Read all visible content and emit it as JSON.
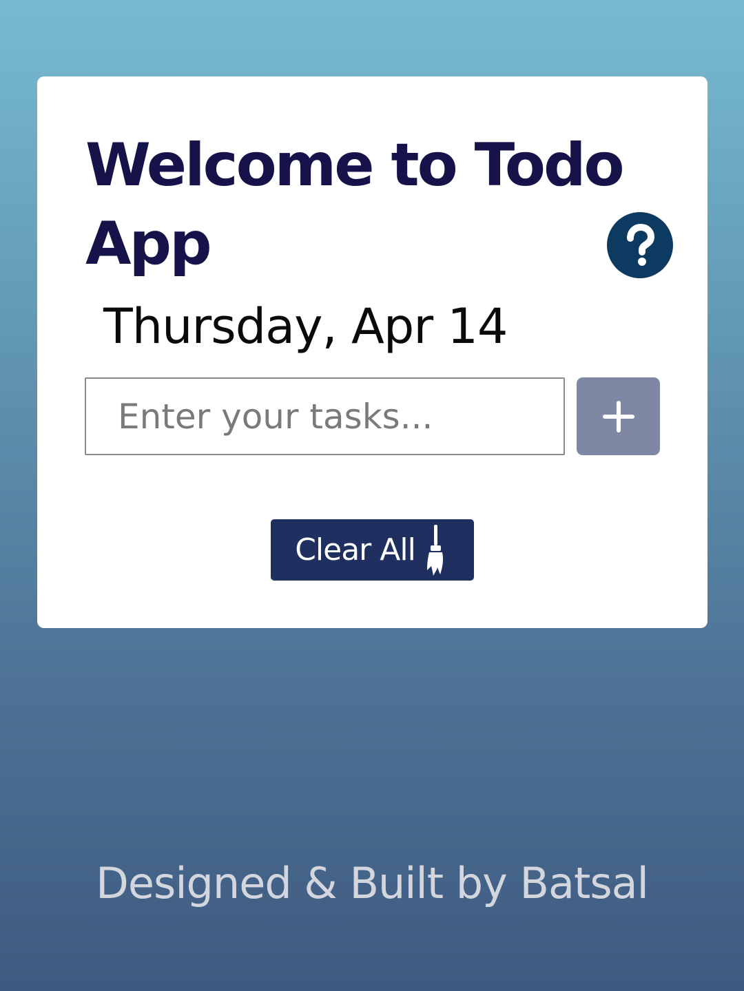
{
  "card": {
    "title": "Welcome to Todo App",
    "date": "Thursday, Apr 14",
    "help_icon": "question-mark-icon",
    "task_input": {
      "value": "",
      "placeholder": "Enter your tasks..."
    },
    "add_button": {
      "icon": "plus-icon"
    },
    "clear_button": {
      "label": "Clear All",
      "icon": "broom-icon"
    }
  },
  "footer": {
    "credit": "Designed & Built by Batsal"
  },
  "colors": {
    "title": "#15134a",
    "help_button": "#0d3a60",
    "add_button": "#7e88a4",
    "clear_button": "#1f2f60",
    "background_top": "#77bbd0",
    "background_bottom": "#3f5a80"
  }
}
